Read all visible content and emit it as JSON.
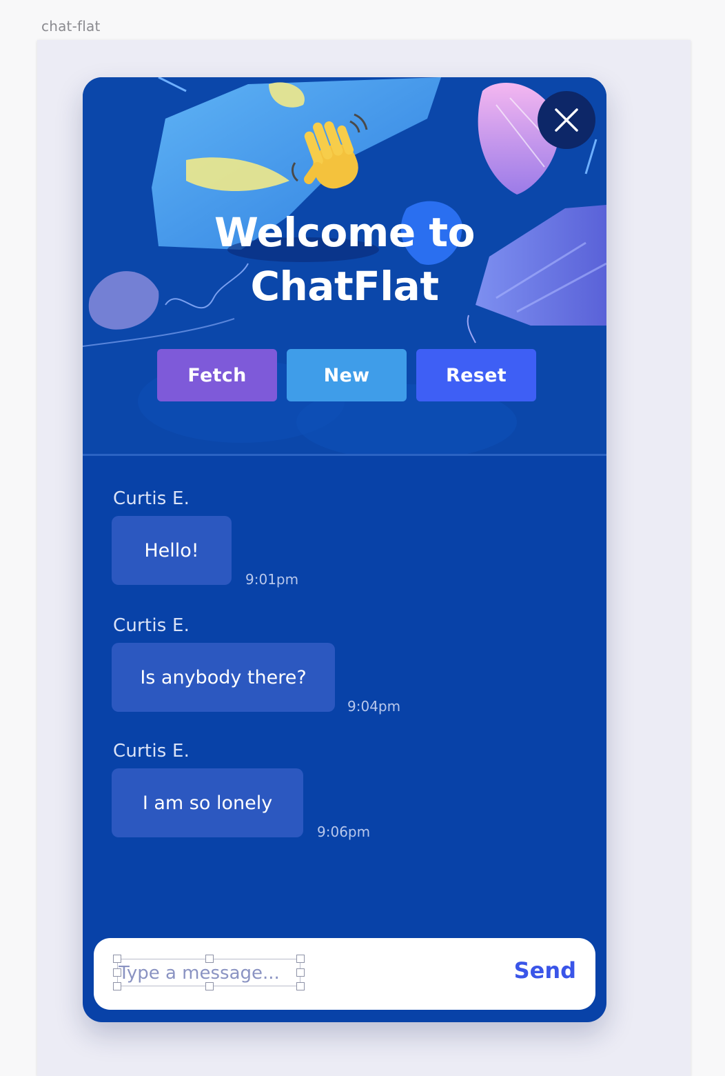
{
  "frame": {
    "label": "chat-flat"
  },
  "header": {
    "title_line1": "Welcome to",
    "title_line2": "ChatFlat",
    "wave_icon": "waving-hand-icon",
    "close_icon": "close-icon"
  },
  "actions": {
    "fetch_label": "Fetch",
    "new_label": "New",
    "reset_label": "Reset"
  },
  "messages": [
    {
      "author": "Curtis E.",
      "text": "Hello!",
      "time": "9:01pm"
    },
    {
      "author": "Curtis E.",
      "text": "Is anybody there?",
      "time": "9:04pm"
    },
    {
      "author": "Curtis E.",
      "text": "I am so lonely",
      "time": "9:06pm"
    }
  ],
  "composer": {
    "placeholder": "Type a message...",
    "value": "",
    "send_label": "Send"
  },
  "colors": {
    "panel": "#0842a8",
    "fetch": "#7e5ad9",
    "new": "#3f9de9",
    "reset": "#3e5ff5",
    "bubble": "#2c58c0",
    "send": "#3a55e8"
  }
}
